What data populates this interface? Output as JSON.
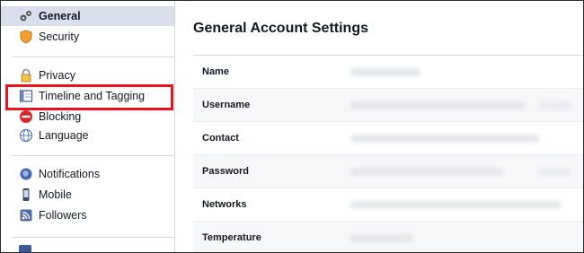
{
  "sidebar": {
    "items": [
      {
        "label": "General",
        "icon": "gears-icon",
        "selected": true
      },
      {
        "label": "Security",
        "icon": "shield-icon"
      },
      {
        "label": "Privacy",
        "icon": "lock-icon"
      },
      {
        "label": "Timeline and Tagging",
        "icon": "timeline-icon"
      },
      {
        "label": "Blocking",
        "icon": "block-icon"
      },
      {
        "label": "Language",
        "icon": "globe-icon"
      },
      {
        "label": "Notifications",
        "icon": "globe-notification-icon"
      },
      {
        "label": "Mobile",
        "icon": "phone-icon"
      },
      {
        "label": "Followers",
        "icon": "rss-icon"
      }
    ]
  },
  "main": {
    "title": "General Account Settings",
    "rows": [
      {
        "label": "Name"
      },
      {
        "label": "Username"
      },
      {
        "label": "Contact"
      },
      {
        "label": "Password"
      },
      {
        "label": "Networks"
      },
      {
        "label": "Temperature"
      }
    ]
  },
  "colors": {
    "accent": "#e8141c",
    "selected_bg": "#d8dfea"
  }
}
